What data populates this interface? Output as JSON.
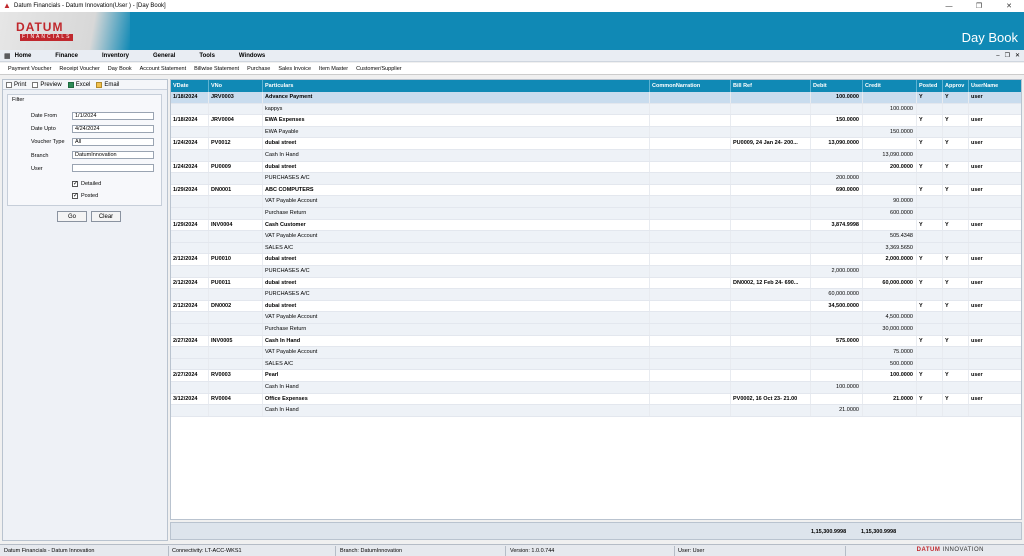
{
  "window": {
    "title": "Datum Financials - Datum Innovation(User    ) - [Day Book]"
  },
  "banner": {
    "logo": "DATUM",
    "logo_sub": "FINANCIALS",
    "screen_title": "Day Book"
  },
  "menu": [
    "Home",
    "Finance",
    "Inventory",
    "General",
    "Tools",
    "Windows"
  ],
  "toolbar": [
    "Payment Voucher",
    "Receipt Voucher",
    "Day Book",
    "Account Statement",
    "Billwise Statement",
    "Purchase",
    "Sales Invoice",
    "Item Master",
    "Customer/Supplier"
  ],
  "left_tools": [
    "Print",
    "Preview",
    "Excel",
    "Email"
  ],
  "filter": {
    "legend": "Filter",
    "date_from_label": "Date From",
    "date_from": "1/1/2024",
    "date_upto_label": "Date Upto",
    "date_upto": "4/24/2024",
    "voucher_type_label": "Voucher Type",
    "voucher_type": "All",
    "branch_label": "Branch",
    "branch": "DatumInnovation",
    "user_label": "User",
    "user": "",
    "detailed_label": "Detailed",
    "posted_label": "Posted",
    "go_label": "Go",
    "clear_label": "Clear"
  },
  "grid": {
    "columns": [
      "VDate",
      "VNo",
      "Particulars",
      "CommonNarration",
      "Bill Ref",
      "Debit",
      "Credit",
      "Posted",
      "Approv",
      "UserName"
    ],
    "rows": [
      {
        "h": 1,
        "sel": 1,
        "c": [
          "1/18/2024",
          "JRV0003",
          "Advance Payment",
          "",
          "",
          "100.0000",
          "",
          "Y",
          "Y",
          "user"
        ]
      },
      {
        "h": 0,
        "c": [
          "",
          "",
          "kappys",
          "",
          "",
          "",
          "100.0000",
          "",
          "",
          ""
        ]
      },
      {
        "h": 1,
        "c": [
          "1/18/2024",
          "JRV0004",
          "EWA Expenses",
          "",
          "",
          "150.0000",
          "",
          "Y",
          "Y",
          "user"
        ]
      },
      {
        "h": 0,
        "c": [
          "",
          "",
          "EWA Payable",
          "",
          "",
          "",
          "150.0000",
          "",
          "",
          ""
        ]
      },
      {
        "h": 1,
        "c": [
          "1/24/2024",
          "PV0012",
          "dubai street",
          "",
          "PU0009, 24 Jan 24- 200...",
          "13,090.0000",
          "",
          "Y",
          "Y",
          "user"
        ]
      },
      {
        "h": 0,
        "c": [
          "",
          "",
          "Cash In Hand",
          "",
          "",
          "",
          "13,090.0000",
          "",
          "",
          ""
        ]
      },
      {
        "h": 1,
        "c": [
          "1/24/2024",
          "PU0009",
          "dubai street",
          "",
          "",
          "",
          "200.0000",
          "Y",
          "Y",
          "user"
        ]
      },
      {
        "h": 0,
        "c": [
          "",
          "",
          "PURCHASES A/C",
          "",
          "",
          "200.0000",
          "",
          "",
          "",
          ""
        ]
      },
      {
        "h": 1,
        "c": [
          "1/29/2024",
          "DN0001",
          "ABC COMPUTERS",
          "",
          "",
          "690.0000",
          "",
          "Y",
          "Y",
          "user"
        ]
      },
      {
        "h": 0,
        "c": [
          "",
          "",
          "VAT Payable Account",
          "",
          "",
          "",
          "90.0000",
          "",
          "",
          ""
        ]
      },
      {
        "h": 0,
        "c": [
          "",
          "",
          "Purchase Return",
          "",
          "",
          "",
          "600.0000",
          "",
          "",
          ""
        ]
      },
      {
        "h": 1,
        "c": [
          "1/29/2024",
          "INV0004",
          "Cash Customer",
          "",
          "",
          "3,874.9998",
          "",
          "Y",
          "Y",
          "user"
        ]
      },
      {
        "h": 0,
        "c": [
          "",
          "",
          "VAT Payable Account",
          "",
          "",
          "",
          "505.4348",
          "",
          "",
          ""
        ]
      },
      {
        "h": 0,
        "c": [
          "",
          "",
          "SALES A/C",
          "",
          "",
          "",
          "3,369.5650",
          "",
          "",
          ""
        ]
      },
      {
        "h": 1,
        "c": [
          "2/12/2024",
          "PU0010",
          "dubai street",
          "",
          "",
          "",
          "2,000.0000",
          "Y",
          "Y",
          "user"
        ]
      },
      {
        "h": 0,
        "c": [
          "",
          "",
          "PURCHASES A/C",
          "",
          "",
          "2,000.0000",
          "",
          "",
          "",
          ""
        ]
      },
      {
        "h": 1,
        "c": [
          "2/12/2024",
          "PU0011",
          "dubai street",
          "",
          "DN0002, 12 Feb 24- 690...",
          "",
          "60,000.0000",
          "Y",
          "Y",
          "user"
        ]
      },
      {
        "h": 0,
        "c": [
          "",
          "",
          "PURCHASES A/C",
          "",
          "",
          "60,000.0000",
          "",
          "",
          "",
          ""
        ]
      },
      {
        "h": 1,
        "c": [
          "2/12/2024",
          "DN0002",
          "dubai street",
          "",
          "",
          "34,500.0000",
          "",
          "Y",
          "Y",
          "user"
        ]
      },
      {
        "h": 0,
        "c": [
          "",
          "",
          "VAT Payable Account",
          "",
          "",
          "",
          "4,500.0000",
          "",
          "",
          ""
        ]
      },
      {
        "h": 0,
        "c": [
          "",
          "",
          "Purchase Return",
          "",
          "",
          "",
          "30,000.0000",
          "",
          "",
          ""
        ]
      },
      {
        "h": 1,
        "c": [
          "2/27/2024",
          "INV0005",
          "Cash In Hand",
          "",
          "",
          "575.0000",
          "",
          "Y",
          "Y",
          "user"
        ]
      },
      {
        "h": 0,
        "c": [
          "",
          "",
          "VAT Payable Account",
          "",
          "",
          "",
          "75.0000",
          "",
          "",
          ""
        ]
      },
      {
        "h": 0,
        "c": [
          "",
          "",
          "SALES A/C",
          "",
          "",
          "",
          "500.0000",
          "",
          "",
          ""
        ]
      },
      {
        "h": 1,
        "c": [
          "2/27/2024",
          "RV0003",
          "Pearl",
          "",
          "",
          "",
          "100.0000",
          "Y",
          "Y",
          "user"
        ]
      },
      {
        "h": 0,
        "c": [
          "",
          "",
          "Cash In Hand",
          "",
          "",
          "100.0000",
          "",
          "",
          "",
          ""
        ]
      },
      {
        "h": 1,
        "c": [
          "3/12/2024",
          "RV0004",
          "Office Expenses",
          "",
          "PV0002, 16 Oct 23- 21.00",
          "",
          "21.0000",
          "Y",
          "Y",
          "user"
        ]
      },
      {
        "h": 0,
        "c": [
          "",
          "",
          "Cash In Hand",
          "",
          "",
          "21.0000",
          "",
          "",
          "",
          ""
        ]
      }
    ],
    "total_debit": "1,15,300.9998",
    "total_credit": "1,15,300.9998"
  },
  "status": {
    "app": "Datum Financials - Datum Innovation",
    "connectivity": "Connectivity: LT-ACC-WKS1",
    "branch": "Branch: DatumInnovation",
    "version": "Version: 1.0.0.744",
    "user": "User:  User",
    "brand_a": "DATUM",
    "brand_b": " INNOVATION"
  },
  "colors": {
    "brand_blue": "#1089b5",
    "brand_red": "#c0282d"
  }
}
